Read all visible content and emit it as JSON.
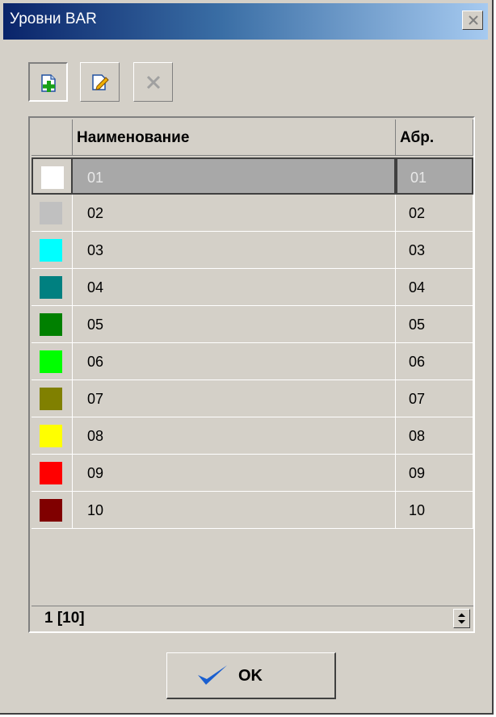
{
  "window": {
    "title": "Уровни BAR"
  },
  "toolbar": {
    "buttons": [
      {
        "name": "add",
        "icon": "document-add-icon",
        "enabled": true
      },
      {
        "name": "edit",
        "icon": "document-edit-icon",
        "enabled": true
      },
      {
        "name": "delete",
        "icon": "delete-x-icon",
        "enabled": false
      }
    ]
  },
  "grid": {
    "columns": [
      "",
      "Наименование",
      "Абр."
    ],
    "rows": [
      {
        "color": "#ffffff",
        "name": "01",
        "abbr": "01"
      },
      {
        "color": "#c0c0c0",
        "name": "02",
        "abbr": "02"
      },
      {
        "color": "#00ffff",
        "name": "03",
        "abbr": "03"
      },
      {
        "color": "#008080",
        "name": "04",
        "abbr": "04"
      },
      {
        "color": "#008000",
        "name": "05",
        "abbr": "05"
      },
      {
        "color": "#00ff00",
        "name": "06",
        "abbr": "06"
      },
      {
        "color": "#808000",
        "name": "07",
        "abbr": "07"
      },
      {
        "color": "#ffff00",
        "name": "08",
        "abbr": "08"
      },
      {
        "color": "#ff0000",
        "name": "09",
        "abbr": "09"
      },
      {
        "color": "#800000",
        "name": "10",
        "abbr": "10"
      }
    ],
    "selected_index": 0,
    "status": "1 [10]"
  },
  "footer": {
    "ok_label": "OK"
  },
  "colors": {
    "face": "#d4d0c8",
    "title_start": "#0a246a",
    "title_end": "#a6caf0",
    "selected_row": "#a8a8a8",
    "check_blue": "#1a5fd0"
  }
}
